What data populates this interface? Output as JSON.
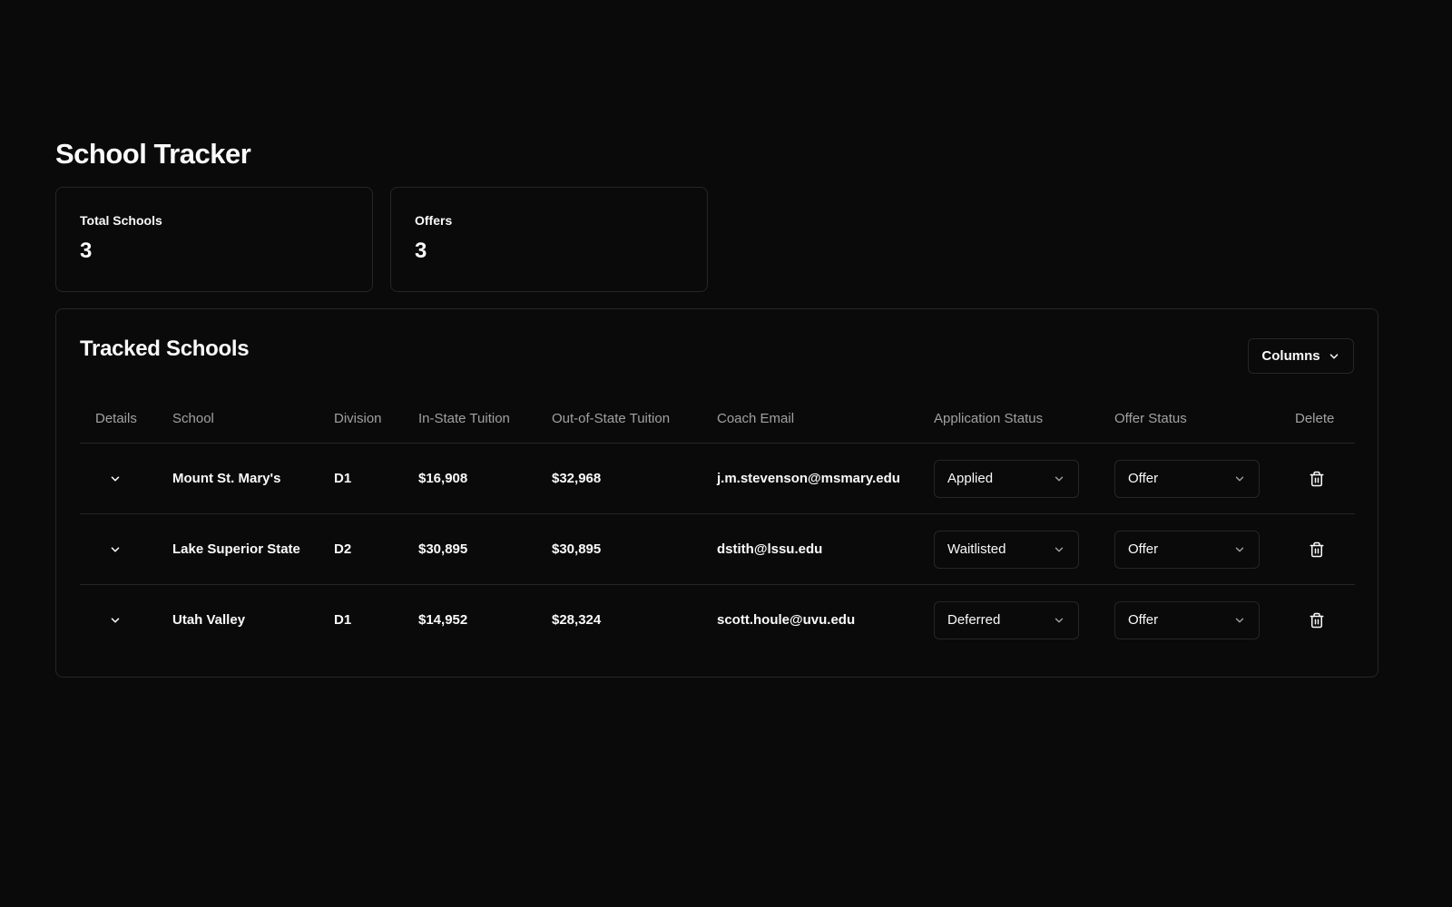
{
  "page": {
    "title": "School Tracker"
  },
  "stats": {
    "total_schools": {
      "label": "Total Schools",
      "value": "3"
    },
    "offers": {
      "label": "Offers",
      "value": "3"
    }
  },
  "tracked": {
    "title": "Tracked Schools",
    "columns_button": "Columns",
    "headers": {
      "details": "Details",
      "school": "School",
      "division": "Division",
      "in_state": "In-State Tuition",
      "out_state": "Out-of-State Tuition",
      "email": "Coach Email",
      "app_status": "Application Status",
      "offer_status": "Offer Status",
      "delete": "Delete"
    },
    "rows": [
      {
        "school": "Mount St. Mary's",
        "division": "D1",
        "in_state": "$16,908",
        "out_state": "$32,968",
        "email": "j.m.stevenson@msmary.edu",
        "app_status": "Applied",
        "offer_status": "Offer"
      },
      {
        "school": "Lake Superior State",
        "division": "D2",
        "in_state": "$30,895",
        "out_state": "$30,895",
        "email": "dstith@lssu.edu",
        "app_status": "Waitlisted",
        "offer_status": "Offer"
      },
      {
        "school": "Utah Valley",
        "division": "D1",
        "in_state": "$14,952",
        "out_state": "$28,324",
        "email": "scott.houle@uvu.edu",
        "app_status": "Deferred",
        "offer_status": "Offer"
      }
    ]
  },
  "icons": {
    "expand": "chevron-down-icon",
    "dropdown": "chevron-down-icon",
    "delete": "trash-icon"
  },
  "colors": {
    "background": "#0a0a0a",
    "border": "#262626",
    "text": "#fafafa",
    "muted": "#a1a1a1"
  }
}
